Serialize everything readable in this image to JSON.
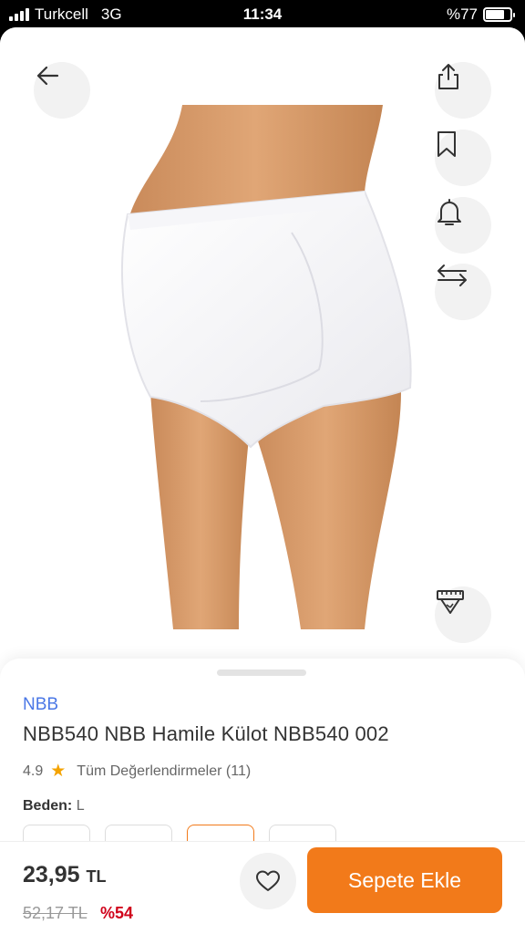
{
  "status": {
    "carrier": "Turkcell",
    "network": "3G",
    "time": "11:34",
    "battery": "%77"
  },
  "icons": {
    "back": "arrow-left-icon",
    "share": "share-icon",
    "bookmark": "bookmark-icon",
    "alarm": "bell-icon",
    "compare": "compare-arrows-icon",
    "size_guide": "measuring-tape-icon",
    "favorite": "heart-icon"
  },
  "product": {
    "brand": "NBB",
    "title": "NBB540 NBB Hamile Külot NBB540 002",
    "rating": "4.9",
    "reviews_label": "Tüm Değerlendirmeler (11)",
    "size_label": "Beden:",
    "size_value": "L",
    "size_options_selected_index": 2
  },
  "purchase": {
    "price": "23,95",
    "currency": "TL",
    "old_price": "52,17 TL",
    "discount": "%54",
    "add_to_cart": "Sepete Ekle"
  },
  "colors": {
    "accent": "#f27a1a",
    "brand_link": "#4a77e6",
    "discount": "#d0021b",
    "star": "#f4a300"
  }
}
